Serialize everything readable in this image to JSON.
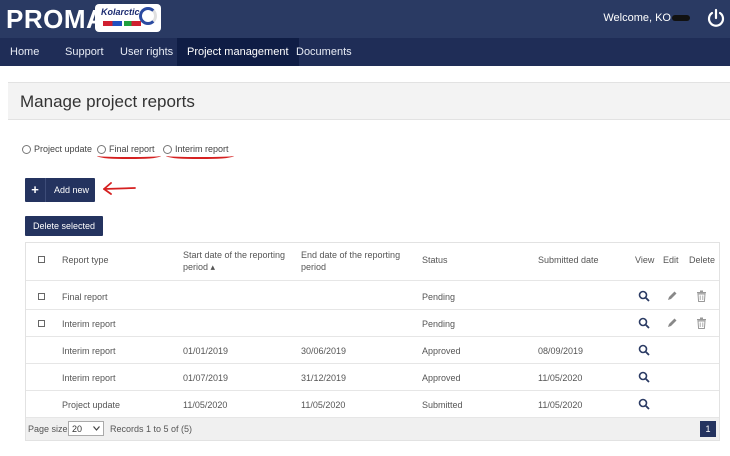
{
  "header": {
    "brand": "PROMAS",
    "logo_text": "Kolarctic",
    "welcome": "Welcome, KO"
  },
  "nav": [
    {
      "label": "Home"
    },
    {
      "label": "Support"
    },
    {
      "label": "User rights"
    },
    {
      "label": "Project management",
      "active": true
    },
    {
      "label": "Documents"
    }
  ],
  "page": {
    "title": "Manage project reports"
  },
  "filters": {
    "options": [
      "Project update",
      "Final report",
      "Interim report"
    ]
  },
  "actions": {
    "add_plus": "+",
    "add_label": "Add new",
    "delete_selected": "Delete selected"
  },
  "table": {
    "headers": {
      "report_type": "Report type",
      "start_date": "Start date of the reporting",
      "start_date_2": "period ▴",
      "end_date": "End date of the reporting",
      "end_date_2": "period",
      "status": "Status",
      "submitted": "Submitted date",
      "view": "View",
      "edit": "Edit",
      "delete": "Delete"
    },
    "rows": [
      {
        "type": "Final report",
        "start": "",
        "end": "",
        "status": "Pending",
        "submitted": ""
      },
      {
        "type": "Interim report",
        "start": "",
        "end": "",
        "status": "Pending",
        "submitted": ""
      },
      {
        "type": "Interim report",
        "start": "01/01/2019",
        "end": "30/06/2019",
        "status": "Approved",
        "submitted": "08/09/2019"
      },
      {
        "type": "Interim report",
        "start": "01/07/2019",
        "end": "31/12/2019",
        "status": "Approved",
        "submitted": "11/05/2020"
      },
      {
        "type": "Project update",
        "start": "11/05/2020",
        "end": "11/05/2020",
        "status": "Submitted",
        "submitted": "11/05/2020"
      }
    ]
  },
  "footer": {
    "page_size_label": "Page size :",
    "page_size_value": "20",
    "records": "Records 1 to 5 of (5)",
    "current_page": "1"
  },
  "colors": {
    "topbar": "#2a3a63",
    "navbar": "#1f2d57",
    "primary_button": "#24335f",
    "annotation_red": "#d52020"
  }
}
